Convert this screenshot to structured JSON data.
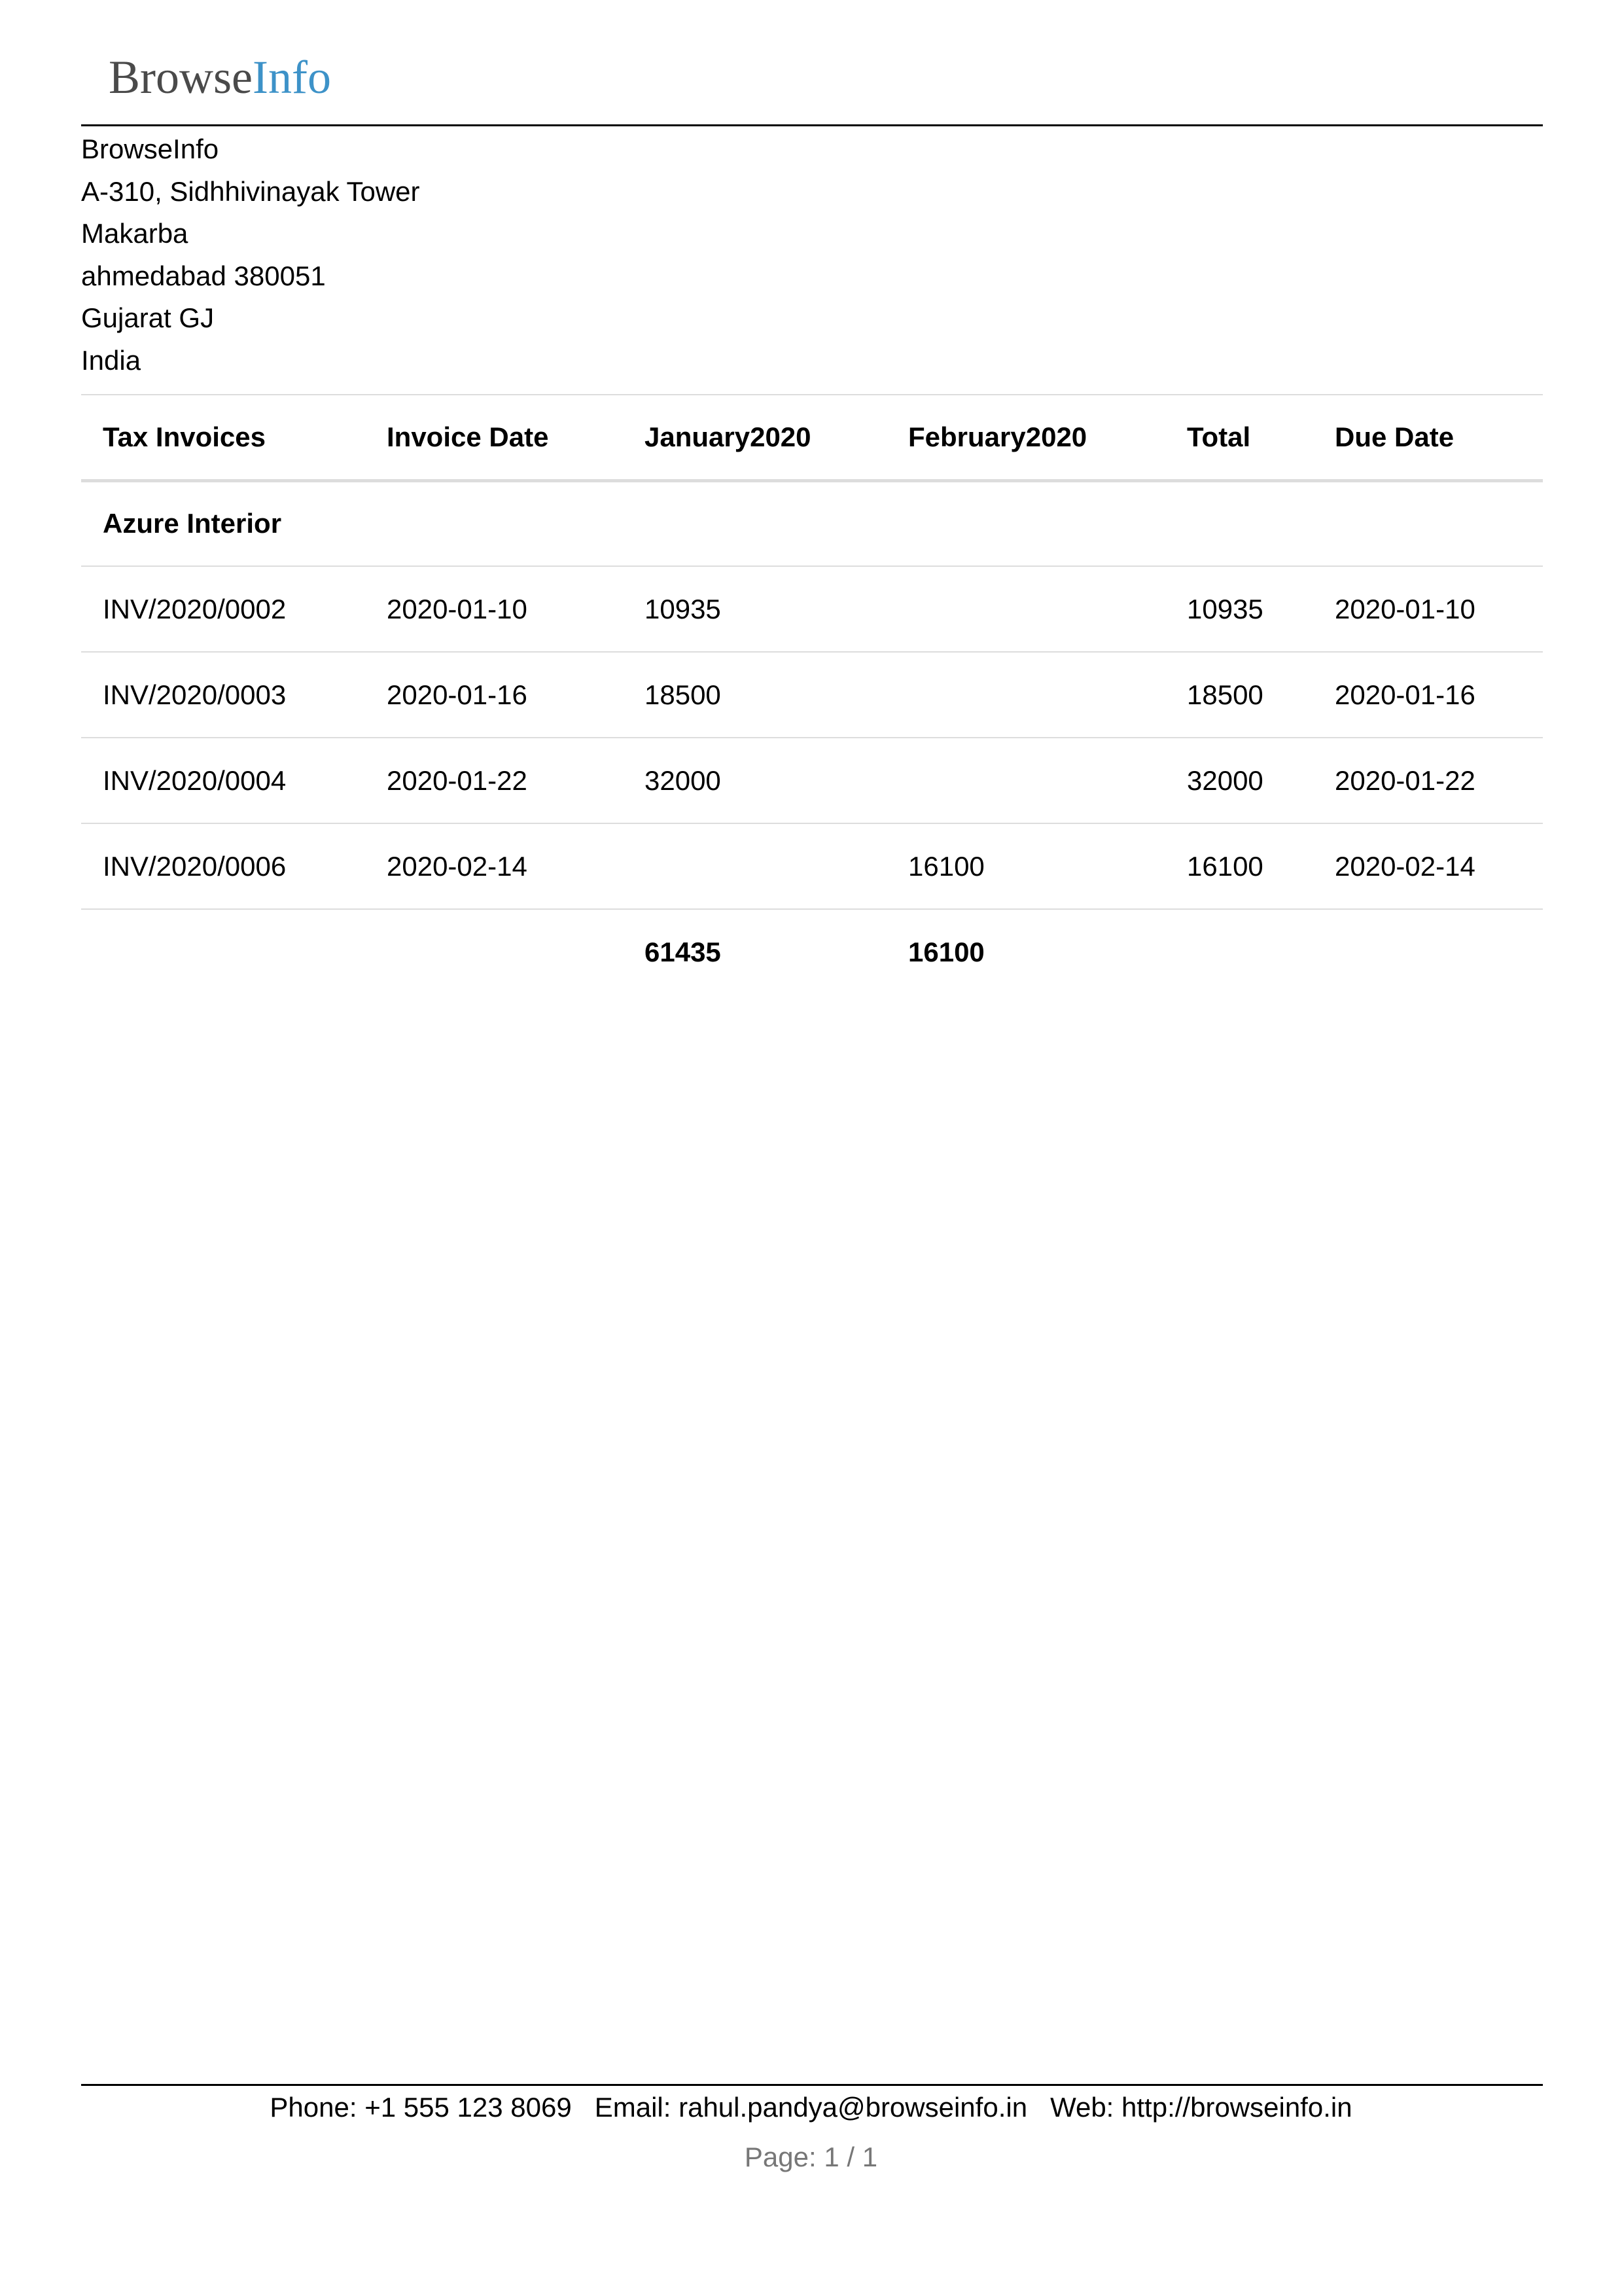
{
  "logo": {
    "part1": "Browse",
    "part2": "Info"
  },
  "company": {
    "name": "BrowseInfo",
    "street": "A-310, Sidhhivinayak Tower",
    "street2": "Makarba",
    "city_zip": "ahmedabad 380051",
    "state": "Gujarat GJ",
    "country": "India"
  },
  "table": {
    "headers": {
      "invoice": "Tax Invoices",
      "date": "Invoice Date",
      "jan": "January2020",
      "feb": "February2020",
      "total": "Total",
      "due": "Due Date"
    },
    "group": "Azure Interior",
    "rows": [
      {
        "invoice": "INV/2020/0002",
        "date": "2020-01-10",
        "jan": "10935",
        "feb": "",
        "total": "10935",
        "due": "2020-01-10"
      },
      {
        "invoice": "INV/2020/0003",
        "date": "2020-01-16",
        "jan": "18500",
        "feb": "",
        "total": "18500",
        "due": "2020-01-16"
      },
      {
        "invoice": "INV/2020/0004",
        "date": "2020-01-22",
        "jan": "32000",
        "feb": "",
        "total": "32000",
        "due": "2020-01-22"
      },
      {
        "invoice": "INV/2020/0006",
        "date": "2020-02-14",
        "jan": "",
        "feb": "16100",
        "total": "16100",
        "due": "2020-02-14"
      }
    ],
    "totals": {
      "jan": "61435",
      "feb": "16100"
    }
  },
  "footer": {
    "phone_label": "Phone:",
    "phone": "+1 555 123 8069",
    "email_label": "Email:",
    "email": "rahul.pandya@browseinfo.in",
    "web_label": "Web:",
    "web": "http://browseinfo.in",
    "page": "Page: 1 / 1"
  }
}
